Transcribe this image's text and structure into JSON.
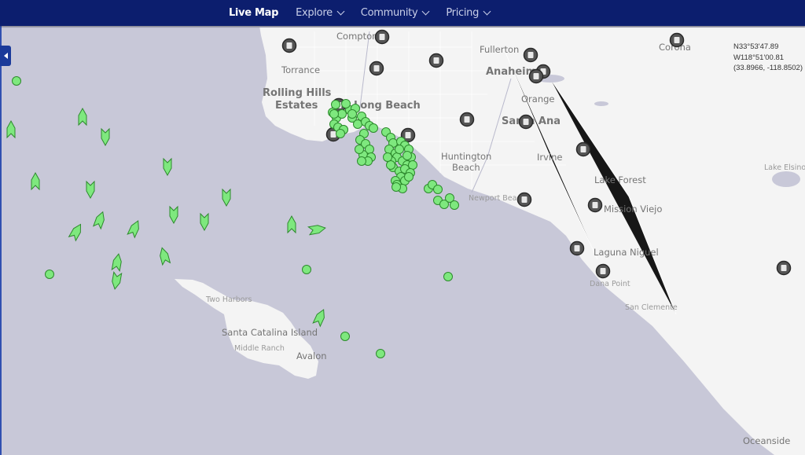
{
  "navbar": {
    "items": [
      {
        "label": "Live Map",
        "active": true,
        "dropdown": false
      },
      {
        "label": "Explore",
        "active": false,
        "dropdown": true
      },
      {
        "label": "Community",
        "active": false,
        "dropdown": true
      },
      {
        "label": "Pricing",
        "active": false,
        "dropdown": true
      }
    ]
  },
  "sidebar_toggle": {
    "icon": "chevron-left-icon"
  },
  "coordinates": {
    "lat_dms": "N33°53'47.89",
    "lon_dms": "W118°51'00.81",
    "decimal": "(33.8966, -118.8502)"
  },
  "map": {
    "colors": {
      "water": "#c8c8d8",
      "land": "#f4f4f4",
      "vessel_fill": "#7ee87e",
      "vessel_stroke": "#2d8a2d",
      "poi_fill": "#555555"
    },
    "place_labels": [
      {
        "name": "Compton",
        "size": "med"
      },
      {
        "name": "Torrance",
        "size": "med"
      },
      {
        "name": "Rolling Hills",
        "size": "big"
      },
      {
        "name": "Estates",
        "size": "big"
      },
      {
        "name": "Long Beach",
        "size": "big"
      },
      {
        "name": "Fullerton",
        "size": "med"
      },
      {
        "name": "Anaheim",
        "size": "big"
      },
      {
        "name": "Orange",
        "size": "med"
      },
      {
        "name": "Santa Ana",
        "size": "big"
      },
      {
        "name": "Huntington",
        "size": "med"
      },
      {
        "name": "Beach",
        "size": "med"
      },
      {
        "name": "Irvine",
        "size": "med"
      },
      {
        "name": "Lake Forest",
        "size": "med"
      },
      {
        "name": "Mission Viejo",
        "size": "med"
      },
      {
        "name": "Newport Beach",
        "size": "small"
      },
      {
        "name": "Laguna Niguel",
        "size": "med"
      },
      {
        "name": "Dana Point",
        "size": "small"
      },
      {
        "name": "San Clemente",
        "size": "small"
      },
      {
        "name": "Oceanside",
        "size": "med"
      },
      {
        "name": "Corona",
        "size": "med"
      },
      {
        "name": "Lake Elsinore",
        "size": "small"
      },
      {
        "name": "Two Harbors",
        "size": "small"
      },
      {
        "name": "Santa Catalina Island",
        "size": "med"
      },
      {
        "name": "Middle Ranch",
        "size": "small"
      },
      {
        "name": "Avalon",
        "size": "med"
      }
    ],
    "poi_markers": [
      {
        "type": "basket-icon"
      },
      {
        "type": "building-icon"
      },
      {
        "type": "truck-icon"
      },
      {
        "type": "chip-icon"
      },
      {
        "type": "person-icon"
      },
      {
        "type": "building-icon"
      },
      {
        "type": "building-icon"
      },
      {
        "type": "fuel-icon"
      },
      {
        "type": "building-icon"
      },
      {
        "type": "basket-icon"
      },
      {
        "type": "basket-icon"
      },
      {
        "type": "basket-icon"
      },
      {
        "type": "fuel-icon"
      },
      {
        "type": "gear-icon"
      },
      {
        "type": "building-icon"
      },
      {
        "type": "gear-icon"
      },
      {
        "type": "gear-icon"
      },
      {
        "type": "chip-icon"
      },
      {
        "type": "building-icon"
      }
    ],
    "vessel_count_visible": 130
  }
}
